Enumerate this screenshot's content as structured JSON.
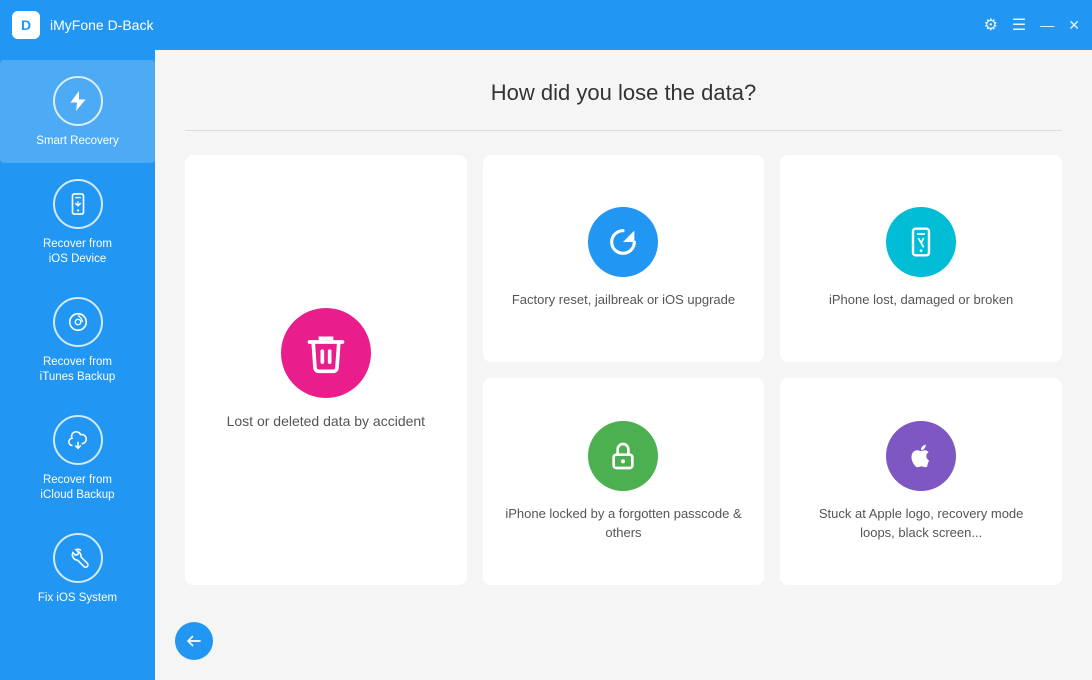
{
  "titleBar": {
    "appName": "iMyFone D-Back",
    "logoLetter": "D",
    "controls": {
      "settings": "⚙",
      "menu": "☰",
      "minimize": "—",
      "close": "✕"
    }
  },
  "sidebar": {
    "items": [
      {
        "id": "smart-recovery",
        "label": "Smart Recovery",
        "icon": "⚡",
        "active": true
      },
      {
        "id": "recover-ios",
        "label": "Recover from\niOS Device",
        "icon": "📱",
        "active": false
      },
      {
        "id": "recover-itunes",
        "label": "Recover from\niTunes Backup",
        "icon": "♪",
        "active": false
      },
      {
        "id": "recover-icloud",
        "label": "Recover from\niCloud Backup",
        "icon": "↓",
        "active": false
      },
      {
        "id": "fix-ios",
        "label": "Fix iOS System",
        "icon": "🔧",
        "active": false
      }
    ]
  },
  "content": {
    "title": "How did you lose the data?",
    "cards": [
      {
        "id": "lost-deleted",
        "label": "Lost or deleted data by accident",
        "iconColor": "bg-red",
        "iconSymbol": "🗑",
        "large": true
      },
      {
        "id": "factory-reset",
        "label": "Factory reset, jailbreak or iOS upgrade",
        "iconColor": "bg-blue",
        "iconSymbol": "↺",
        "large": false
      },
      {
        "id": "iphone-lost",
        "label": "iPhone lost, damaged or broken",
        "iconColor": "bg-teal",
        "iconSymbol": "📱",
        "large": false
      },
      {
        "id": "iphone-locked",
        "label": "iPhone locked by a forgotten passcode & others",
        "iconColor": "bg-green",
        "iconSymbol": "🔒",
        "large": false
      },
      {
        "id": "apple-logo",
        "label": "Stuck at Apple logo, recovery mode loops, black screen...",
        "iconColor": "bg-purple",
        "iconSymbol": "",
        "large": false
      }
    ],
    "backButton": "←"
  }
}
